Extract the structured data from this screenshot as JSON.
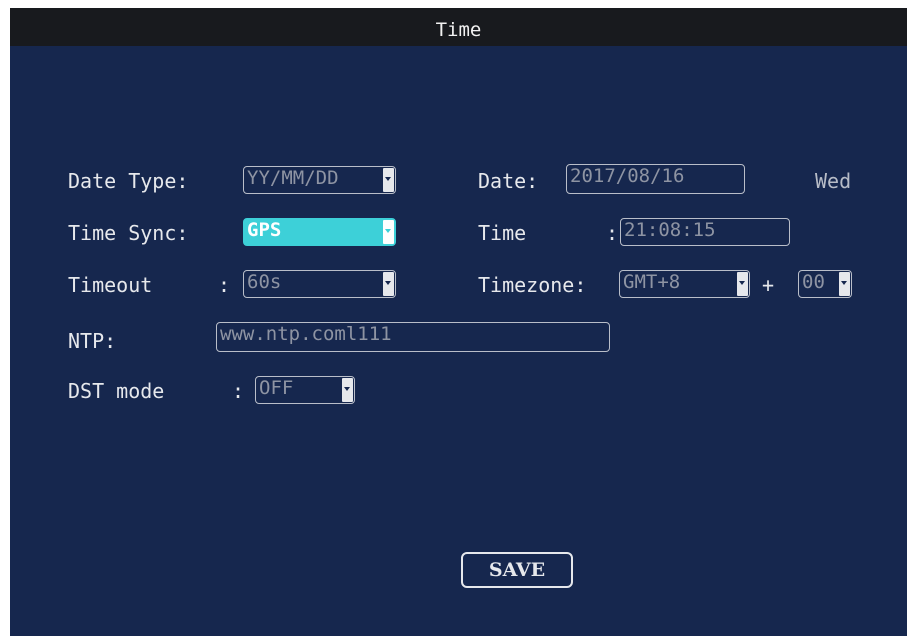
{
  "window": {
    "title": "Time"
  },
  "form": {
    "date_type": {
      "label": "Date Type:",
      "value": "YY/MM/DD"
    },
    "date": {
      "label": "Date:",
      "value": "2017/08/16",
      "weekday": "Wed"
    },
    "time_sync": {
      "label": "Time Sync:",
      "value": "GPS"
    },
    "time": {
      "label": "Time",
      "colon": ":",
      "value": "21:08:15"
    },
    "timeout": {
      "label": "Timeout",
      "colon": ":",
      "value": "60s"
    },
    "timezone": {
      "label": "Timezone:",
      "value": "GMT+8",
      "plus": "+",
      "offset_minutes": "00"
    },
    "ntp": {
      "label": "NTP:",
      "value": "www.ntp.coml111"
    },
    "dst_mode": {
      "label": "DST mode",
      "colon": ":",
      "value": "OFF"
    }
  },
  "buttons": {
    "save_label": "SAVE"
  },
  "colors": {
    "background": "#16274e",
    "titlebar": "#181a1e",
    "selected": "#3dd0d8",
    "text": "#e6e8ec"
  }
}
